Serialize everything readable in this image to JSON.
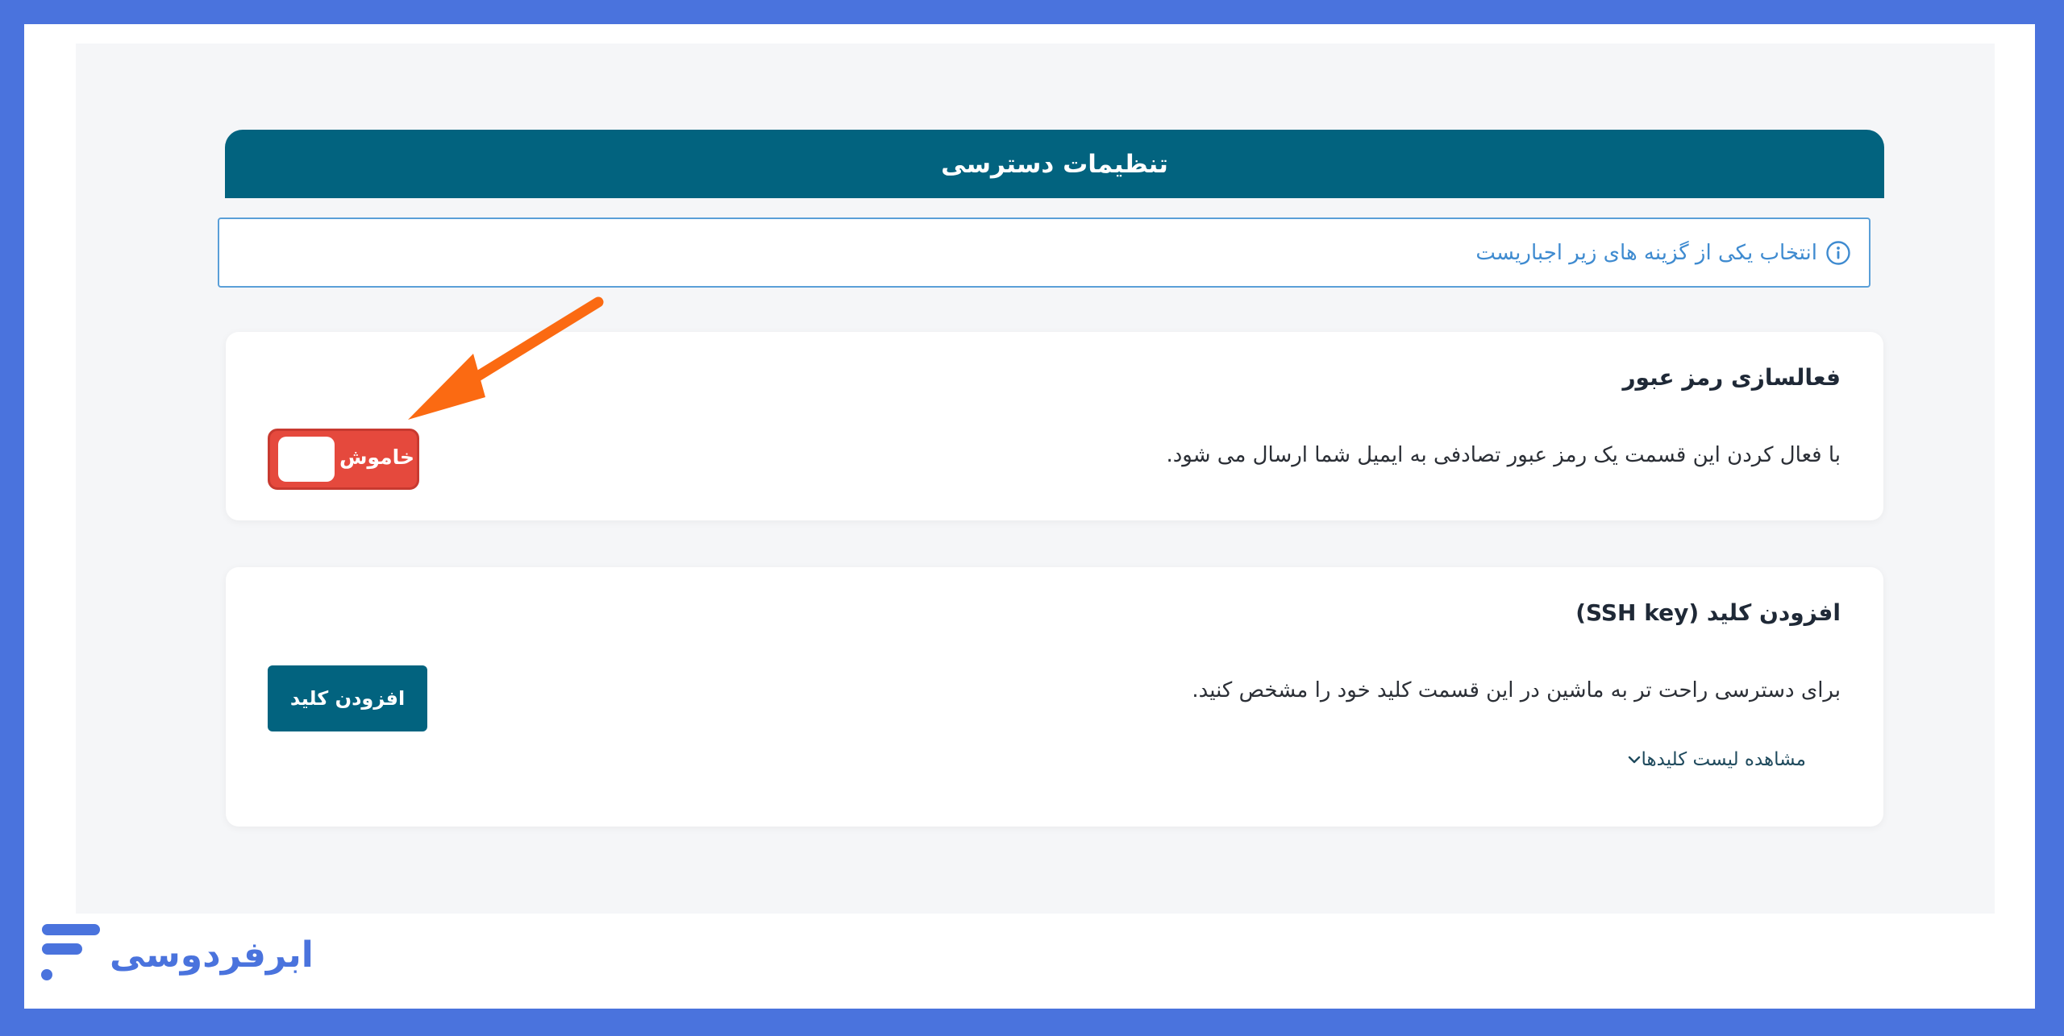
{
  "colors": {
    "outer_frame": "#4a73dd",
    "header_bar": "#02637f",
    "notice_border": "#5a9fd8",
    "notice_text": "#3f8bd0",
    "toggle_off": "#e5493d",
    "primary_button": "#02637f",
    "annotation_arrow": "#fb6a12",
    "brand": "#4a73dd"
  },
  "header": {
    "title": "تنظیمات دسترسی"
  },
  "notice": {
    "icon": "info-icon",
    "text": "انتخاب یکی از گزینه های زیر اجباریست"
  },
  "password_card": {
    "title": "فعالسازی رمز عبور",
    "description": "با فعال کردن این قسمت یک رمز عبور تصادفی به ایمیل شما ارسال می شود.",
    "toggle": {
      "state": "off",
      "label": "خاموش"
    }
  },
  "ssh_card": {
    "title": "افزودن کلید (SSH key)",
    "description": "برای دسترسی راحت تر به ماشین در این قسمت کلید خود را مشخص کنید.",
    "add_button_label": "افزودن کلید",
    "view_keys_label": "مشاهده لیست کلیدها",
    "view_keys_icon": "chevron-down-icon"
  },
  "annotation": {
    "type": "arrow",
    "points_to": "password_card.toggle"
  },
  "brand": {
    "name": "ابرفردوسی",
    "logo_icon": "brand-logo-icon"
  }
}
